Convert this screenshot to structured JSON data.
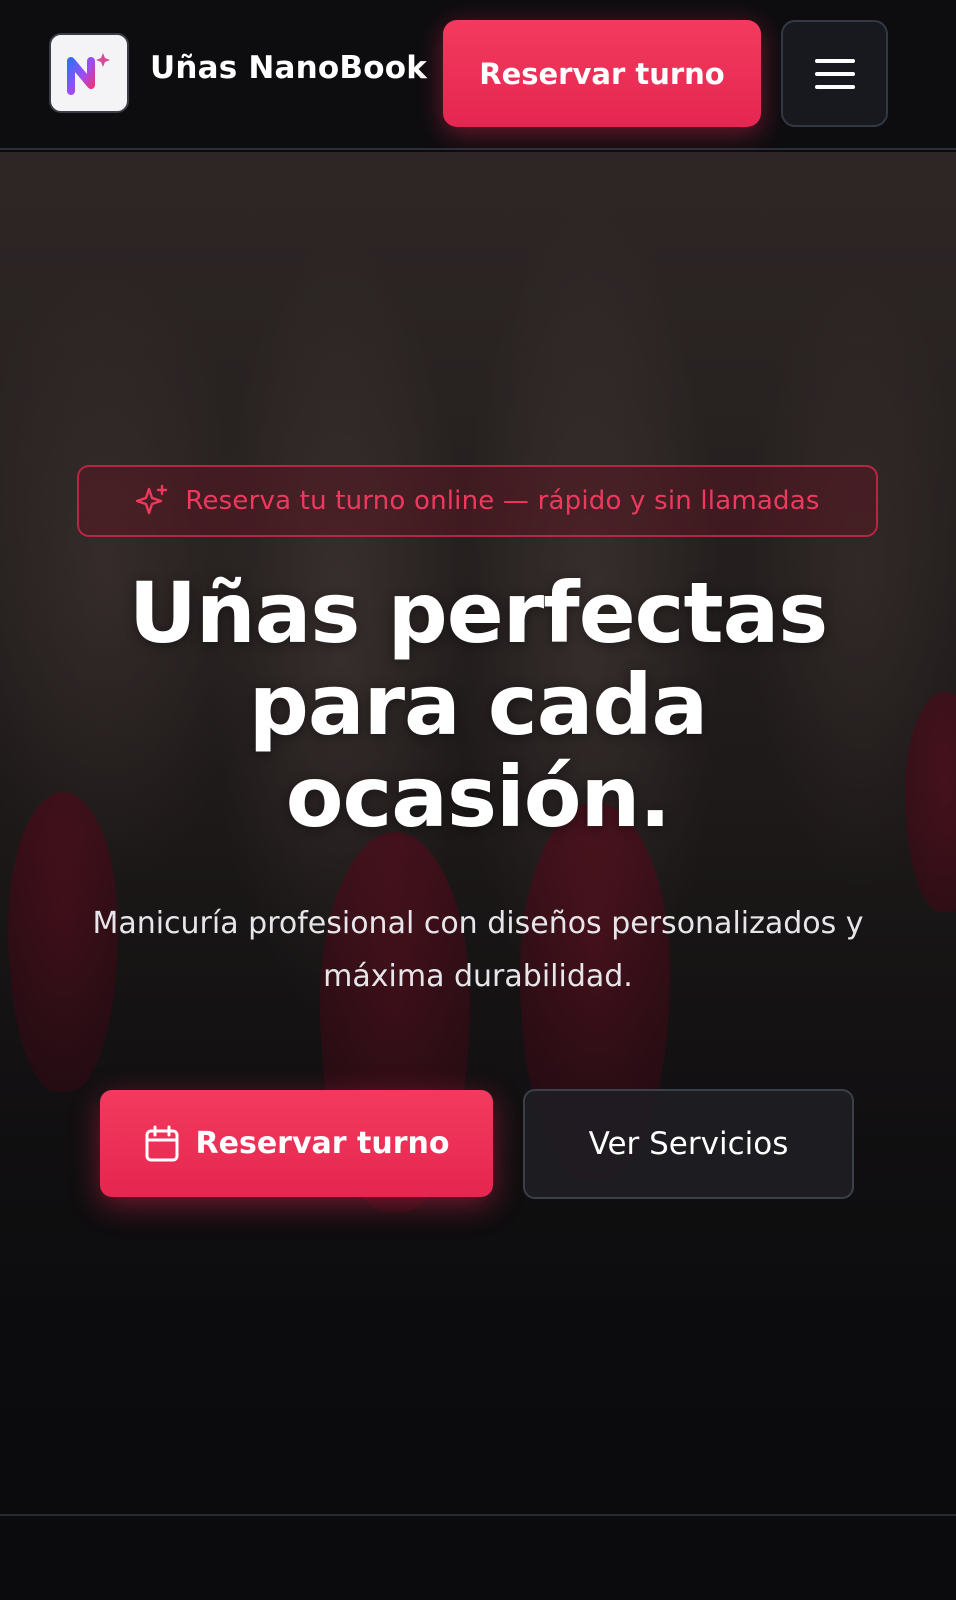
{
  "header": {
    "brand_name": "Uñas NanoBook",
    "logo_icon": "nanobook-logo-icon",
    "cta_label": "Reservar turno",
    "menu_icon": "hamburger-menu-icon"
  },
  "hero": {
    "badge_icon": "sparkle-icon",
    "badge_text": "Reserva tu turno online — rápido y sin llamadas",
    "headline_line1": "Uñas perfectas",
    "headline_line2": "para cada",
    "headline_line3": "ocasión.",
    "subtitle_line1": "Manicuría profesional con diseños personalizados y",
    "subtitle_line2": "máxima durabilidad.",
    "primary_cta_icon": "calendar-icon",
    "primary_cta_label": "Reservar turno",
    "secondary_cta_label": "Ver Servicios"
  },
  "colors": {
    "accent": "#e8294f",
    "background": "#0b0b0e",
    "badge_text": "#f0385e"
  }
}
